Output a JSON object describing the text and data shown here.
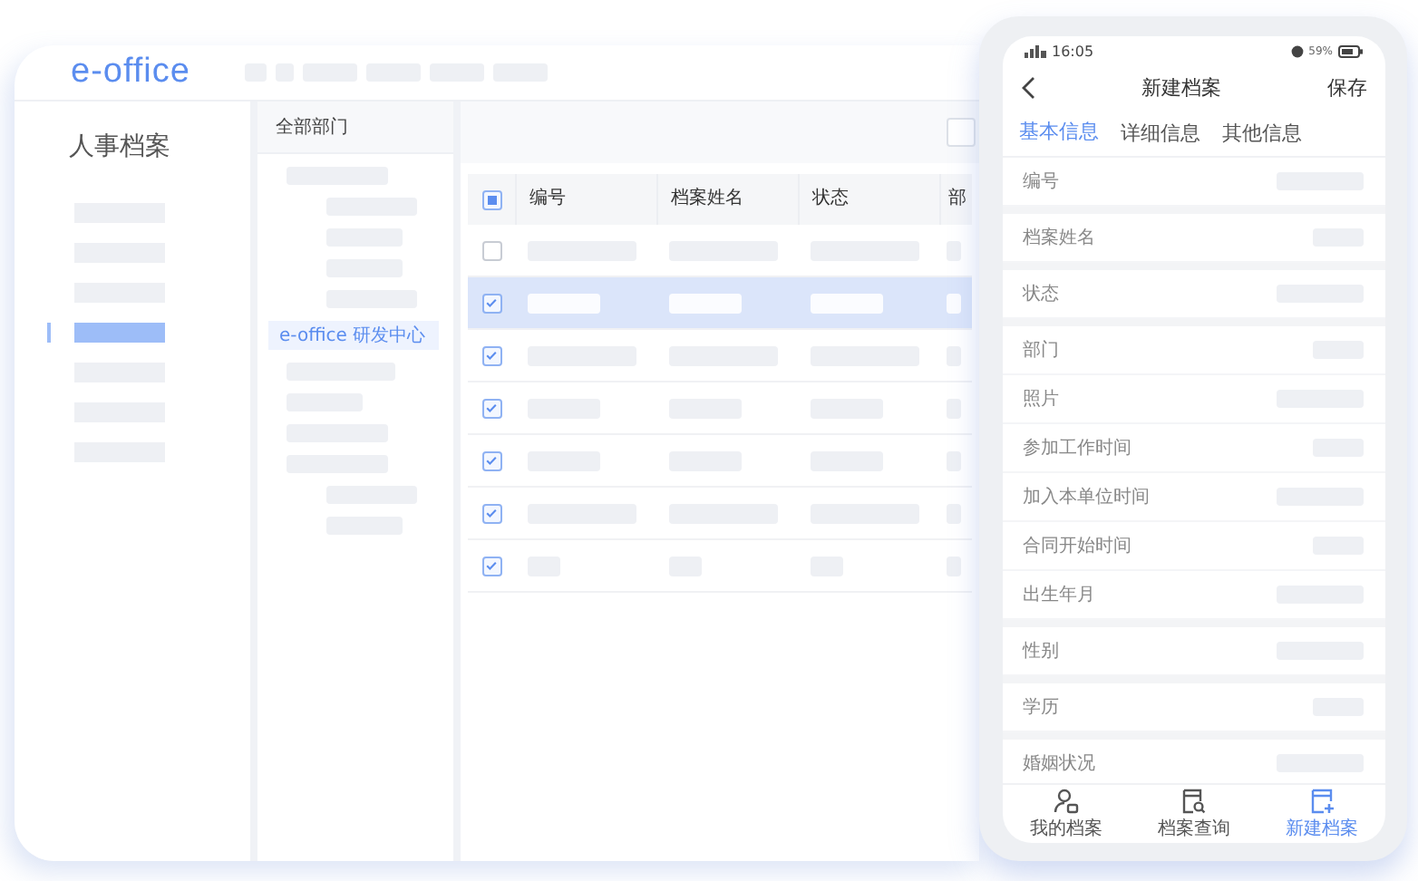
{
  "header": {
    "logo": "e-office"
  },
  "sidebar": {
    "title": "人事档案",
    "items": [
      {
        "selected": false
      },
      {
        "selected": false
      },
      {
        "selected": false
      },
      {
        "selected": true
      },
      {
        "selected": false
      },
      {
        "selected": false
      },
      {
        "selected": false
      }
    ]
  },
  "tree": {
    "title": "全部部门",
    "items": [
      {
        "selected": false,
        "children": [
          {
            "selected": false
          },
          {
            "selected": false
          },
          {
            "selected": false
          },
          {
            "selected": false
          }
        ]
      },
      {
        "label": "e-office 研发中心",
        "selected": true
      },
      {
        "selected": false
      },
      {
        "selected": false
      },
      {
        "selected": false
      },
      {
        "selected": false,
        "children": [
          {
            "selected": false
          },
          {
            "selected": false
          }
        ]
      }
    ]
  },
  "table": {
    "select_all_indeterminate": true,
    "columns": [
      "编号",
      "档案姓名",
      "状态",
      "部"
    ],
    "rows": [
      {
        "checked": false,
        "selected": false
      },
      {
        "checked": true,
        "selected": true
      },
      {
        "checked": true,
        "selected": false
      },
      {
        "checked": true,
        "selected": false
      },
      {
        "checked": true,
        "selected": false
      },
      {
        "checked": true,
        "selected": false
      },
      {
        "checked": true,
        "selected": false
      }
    ]
  },
  "phone": {
    "status_bar": {
      "time": "16:05",
      "battery": "59%"
    },
    "title": "新建档案",
    "action": "保存",
    "tabs": [
      {
        "label": "基本信息",
        "selected": true
      },
      {
        "label": "详细信息",
        "selected": false
      },
      {
        "label": "其他信息",
        "selected": false
      }
    ],
    "groups": [
      [
        "编号"
      ],
      [
        "档案姓名"
      ],
      [
        "状态"
      ],
      [
        "部门",
        "照片",
        "参加工作时间",
        "加入本单位时间",
        "合同开始时间",
        "出生年月"
      ],
      [
        "性别"
      ],
      [
        "学历"
      ],
      [
        "婚姻状况"
      ]
    ],
    "bottom_nav": [
      {
        "label": "我的档案",
        "kind": "person",
        "selected": false
      },
      {
        "label": "档案查询",
        "kind": "search",
        "selected": false
      },
      {
        "label": "新建档案",
        "kind": "add",
        "selected": true
      }
    ]
  }
}
